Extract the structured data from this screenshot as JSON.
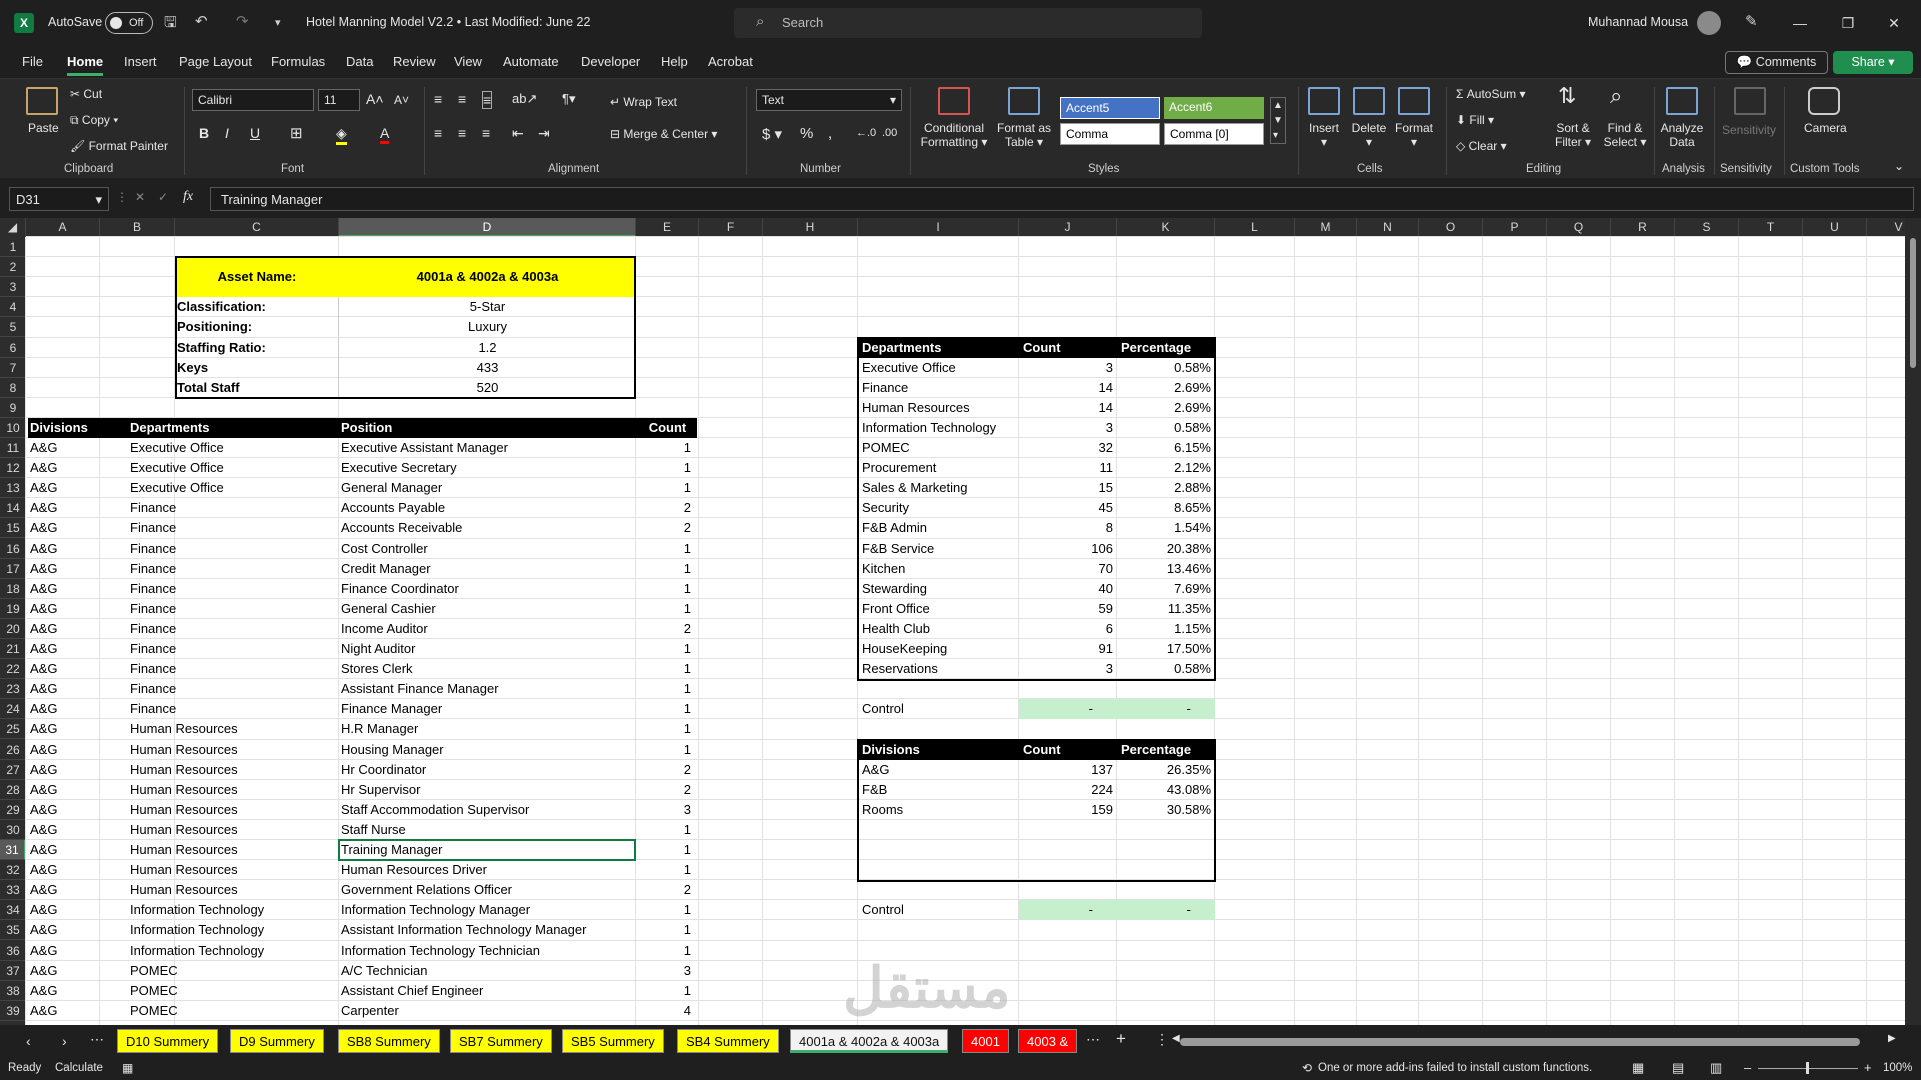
{
  "app": {
    "autosave_label": "AutoSave",
    "autosave_state": "Off",
    "title": "Hotel Manning Model V2.2 • Last Modified: June 22",
    "search_placeholder": "Search",
    "user": "Muhannad Mousa"
  },
  "tabs": [
    "File",
    "Home",
    "Insert",
    "Page Layout",
    "Formulas",
    "Data",
    "Review",
    "View",
    "Automate",
    "Developer",
    "Help",
    "Acrobat"
  ],
  "buttons": {
    "comments": "Comments",
    "share": "Share"
  },
  "ribbon": {
    "paste": "Paste",
    "cut": "Cut",
    "copy": "Copy",
    "format_painter": "Format Painter",
    "clipboard": "Clipboard",
    "font_name": "Calibri",
    "font_size": "11",
    "font": "Font",
    "wrap_text": "Wrap Text",
    "merge_center": "Merge & Center",
    "alignment": "Alignment",
    "number_format": "Text",
    "number": "Number",
    "cond_fmt_1": "Conditional",
    "cond_fmt_2": "Formatting",
    "fmt_table_1": "Format as",
    "fmt_table_2": "Table",
    "style_accent5": "Accent5",
    "style_accent6": "Accent6",
    "style_comma": "Comma",
    "style_comma0": "Comma [0]",
    "styles": "Styles",
    "insert": "Insert",
    "delete": "Delete",
    "format": "Format",
    "cells": "Cells",
    "autosum": "AutoSum",
    "fill": "Fill",
    "clear": "Clear",
    "sort_1": "Sort &",
    "sort_2": "Filter",
    "find_1": "Find &",
    "find_2": "Select",
    "editing": "Editing",
    "analyze_1": "Analyze",
    "analyze_2": "Data",
    "analysis": "Analysis",
    "sensitivity": "Sensitivity",
    "camera": "Camera",
    "custom_tools": "Custom Tools",
    "accent5_color": "#4472c4",
    "accent6_color": "#70ad47"
  },
  "formula": {
    "name_box": "D31",
    "content": "Training Manager"
  },
  "columns": [
    "A",
    "B",
    "C",
    "D",
    "E",
    "F",
    "H",
    "I",
    "J",
    "K",
    "L",
    "M",
    "N",
    "O",
    "P",
    "Q",
    "R",
    "S",
    "T",
    "U",
    "V"
  ],
  "rows": [
    "1",
    "2",
    "3",
    "4",
    "5",
    "6",
    "7",
    "8",
    "9",
    "10",
    "11",
    "12",
    "13",
    "14",
    "15",
    "16",
    "17",
    "18",
    "19",
    "20",
    "21",
    "22",
    "23",
    "24",
    "25",
    "26",
    "27",
    "28",
    "29",
    "30",
    "31",
    "32",
    "33",
    "34",
    "35",
    "36",
    "37",
    "38",
    "39"
  ],
  "asset": {
    "label": "Asset Name:",
    "name": "4001a & 4002a & 4003a",
    "fields": [
      [
        "Classification:",
        "5-Star"
      ],
      [
        "Positioning:",
        "Luxury"
      ],
      [
        "Staffing Ratio:",
        "1.2"
      ],
      [
        "Keys",
        "433"
      ],
      [
        "Total Staff",
        "520"
      ]
    ],
    "highlight_color": "#ffff00"
  },
  "positions": {
    "headers": [
      "Divisions",
      "Departments",
      "Position",
      "Count"
    ],
    "rows": [
      [
        "A&G",
        "Executive Office",
        "Executive Assistant Manager",
        "1"
      ],
      [
        "A&G",
        "Executive Office",
        "Executive Secretary",
        "1"
      ],
      [
        "A&G",
        "Executive Office",
        "General Manager",
        "1"
      ],
      [
        "A&G",
        "Finance",
        "Accounts Payable",
        "2"
      ],
      [
        "A&G",
        "Finance",
        "Accounts Receivable",
        "2"
      ],
      [
        "A&G",
        "Finance",
        "Cost Controller",
        "1"
      ],
      [
        "A&G",
        "Finance",
        "Credit Manager",
        "1"
      ],
      [
        "A&G",
        "Finance",
        "Finance Coordinator",
        "1"
      ],
      [
        "A&G",
        "Finance",
        "General Cashier",
        "1"
      ],
      [
        "A&G",
        "Finance",
        "Income Auditor",
        "2"
      ],
      [
        "A&G",
        "Finance",
        "Night Auditor",
        "1"
      ],
      [
        "A&G",
        "Finance",
        "Stores Clerk",
        "1"
      ],
      [
        "A&G",
        "Finance",
        "Assistant Finance Manager",
        "1"
      ],
      [
        "A&G",
        "Finance",
        "Finance Manager",
        "1"
      ],
      [
        "A&G",
        "Human Resources",
        "H.R Manager",
        "1"
      ],
      [
        "A&G",
        "Human Resources",
        "Housing Manager",
        "1"
      ],
      [
        "A&G",
        "Human Resources",
        "Hr Coordinator",
        "2"
      ],
      [
        "A&G",
        "Human Resources",
        "Hr Supervisor",
        "2"
      ],
      [
        "A&G",
        "Human Resources",
        "Staff Accommodation Supervisor",
        "3"
      ],
      [
        "A&G",
        "Human Resources",
        "Staff Nurse",
        "1"
      ],
      [
        "A&G",
        "Human Resources",
        "Training Manager",
        "1"
      ],
      [
        "A&G",
        "Human Resources",
        "Human Resources Driver",
        "1"
      ],
      [
        "A&G",
        "Human Resources",
        "Government Relations Officer",
        "2"
      ],
      [
        "A&G",
        "Information Technology",
        "Information Technology Manager",
        "1"
      ],
      [
        "A&G",
        "Information Technology",
        "Assistant Information Technology Manager",
        "1"
      ],
      [
        "A&G",
        "Information Technology",
        "Information Technology Technician",
        "1"
      ],
      [
        "A&G",
        "POMEC",
        "A/C Technician",
        "3"
      ],
      [
        "A&G",
        "POMEC",
        "Assistant Chief Engineer",
        "1"
      ],
      [
        "A&G",
        "POMEC",
        "Carpenter",
        "4"
      ]
    ]
  },
  "dept_summary": {
    "headers": [
      "Departments",
      "Count",
      "Percentage"
    ],
    "rows": [
      [
        "Executive Office",
        "3",
        "0.58%"
      ],
      [
        "Finance",
        "14",
        "2.69%"
      ],
      [
        "Human Resources",
        "14",
        "2.69%"
      ],
      [
        "Information Technology",
        "3",
        "0.58%"
      ],
      [
        "POMEC",
        "32",
        "6.15%"
      ],
      [
        "Procurement",
        "11",
        "2.12%"
      ],
      [
        "Sales & Marketing",
        "15",
        "2.88%"
      ],
      [
        "Security",
        "45",
        "8.65%"
      ],
      [
        "F&B Admin",
        "8",
        "1.54%"
      ],
      [
        "F&B Service",
        "106",
        "20.38%"
      ],
      [
        "Kitchen",
        "70",
        "13.46%"
      ],
      [
        "Stewarding",
        "40",
        "7.69%"
      ],
      [
        "Front Office",
        "59",
        "11.35%"
      ],
      [
        "Health Club",
        "6",
        "1.15%"
      ],
      [
        "HouseKeeping",
        "91",
        "17.50%"
      ],
      [
        "Reservations",
        "3",
        "0.58%"
      ]
    ],
    "control": [
      "Control",
      "-",
      "-"
    ]
  },
  "div_summary": {
    "headers": [
      "Divisions",
      "Count",
      "Percentage"
    ],
    "rows": [
      [
        "A&G",
        "137",
        "26.35%"
      ],
      [
        "F&B",
        "224",
        "43.08%"
      ],
      [
        "Rooms",
        "159",
        "30.58%"
      ]
    ],
    "control": [
      "Control",
      "-",
      "-"
    ]
  },
  "watermark": "مستقل",
  "sheets": [
    {
      "label": "D10 Summery",
      "color": "#ffff00"
    },
    {
      "label": "D9 Summery",
      "color": "#ffff00"
    },
    {
      "label": "SB8 Summery",
      "color": "#ffff00"
    },
    {
      "label": "SB7 Summery",
      "color": "#ffff00"
    },
    {
      "label": "SB5 Summery",
      "color": "#ffff00"
    },
    {
      "label": "SB4 Summery",
      "color": "#ffff00"
    },
    {
      "label": "4001a & 4002a & 4003a",
      "color": "#f2f2f2",
      "active": true
    },
    {
      "label": "4001",
      "color": "#ff0000"
    },
    {
      "label": "4003 &",
      "color": "#ff0000"
    }
  ],
  "status": {
    "ready": "Ready",
    "calculate": "Calculate",
    "message": "One or more add-ins failed to install custom functions.",
    "zoom": "100%"
  }
}
